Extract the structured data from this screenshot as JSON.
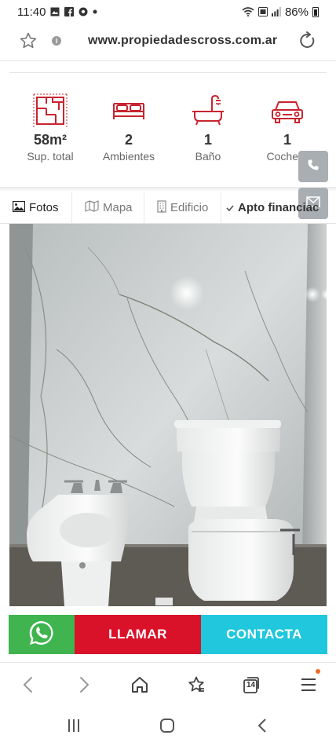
{
  "status_bar": {
    "time": "11:40",
    "battery": "86%",
    "notification_icons": [
      "gallery-icon",
      "facebook-icon",
      "soccer-icon",
      "dot-icon"
    ],
    "system_icons": [
      "wifi-icon",
      "volte-icon",
      "signal-icon",
      "battery-icon"
    ]
  },
  "browser": {
    "url": "www.propiedadescross.com.ar",
    "tabs_count": "14"
  },
  "features": [
    {
      "value": "58m²",
      "label": "Sup. total",
      "icon": "floorplan-icon"
    },
    {
      "value": "2",
      "label": "Ambientes",
      "icon": "bed-icon"
    },
    {
      "value": "1",
      "label": "Baño",
      "icon": "bathtub-icon"
    },
    {
      "value": "1",
      "label": "Cochera",
      "icon": "car-icon"
    }
  ],
  "tabs": [
    {
      "label": "Fotos",
      "icon": "image-icon"
    },
    {
      "label": "Mapa",
      "icon": "map-icon"
    },
    {
      "label": "Edificio",
      "icon": "building-icon"
    },
    {
      "label": "Apto financiac",
      "icon": "check-icon"
    }
  ],
  "cta": {
    "whatsapp_icon": "whatsapp-icon",
    "call_label": "LLAMAR",
    "contact_label": "CONTACTA"
  },
  "colors": {
    "accent_red": "#d9122a",
    "whatsapp_green": "#3fb44f",
    "contact_cyan": "#20c7dd",
    "icon_red": "#c8242f"
  }
}
